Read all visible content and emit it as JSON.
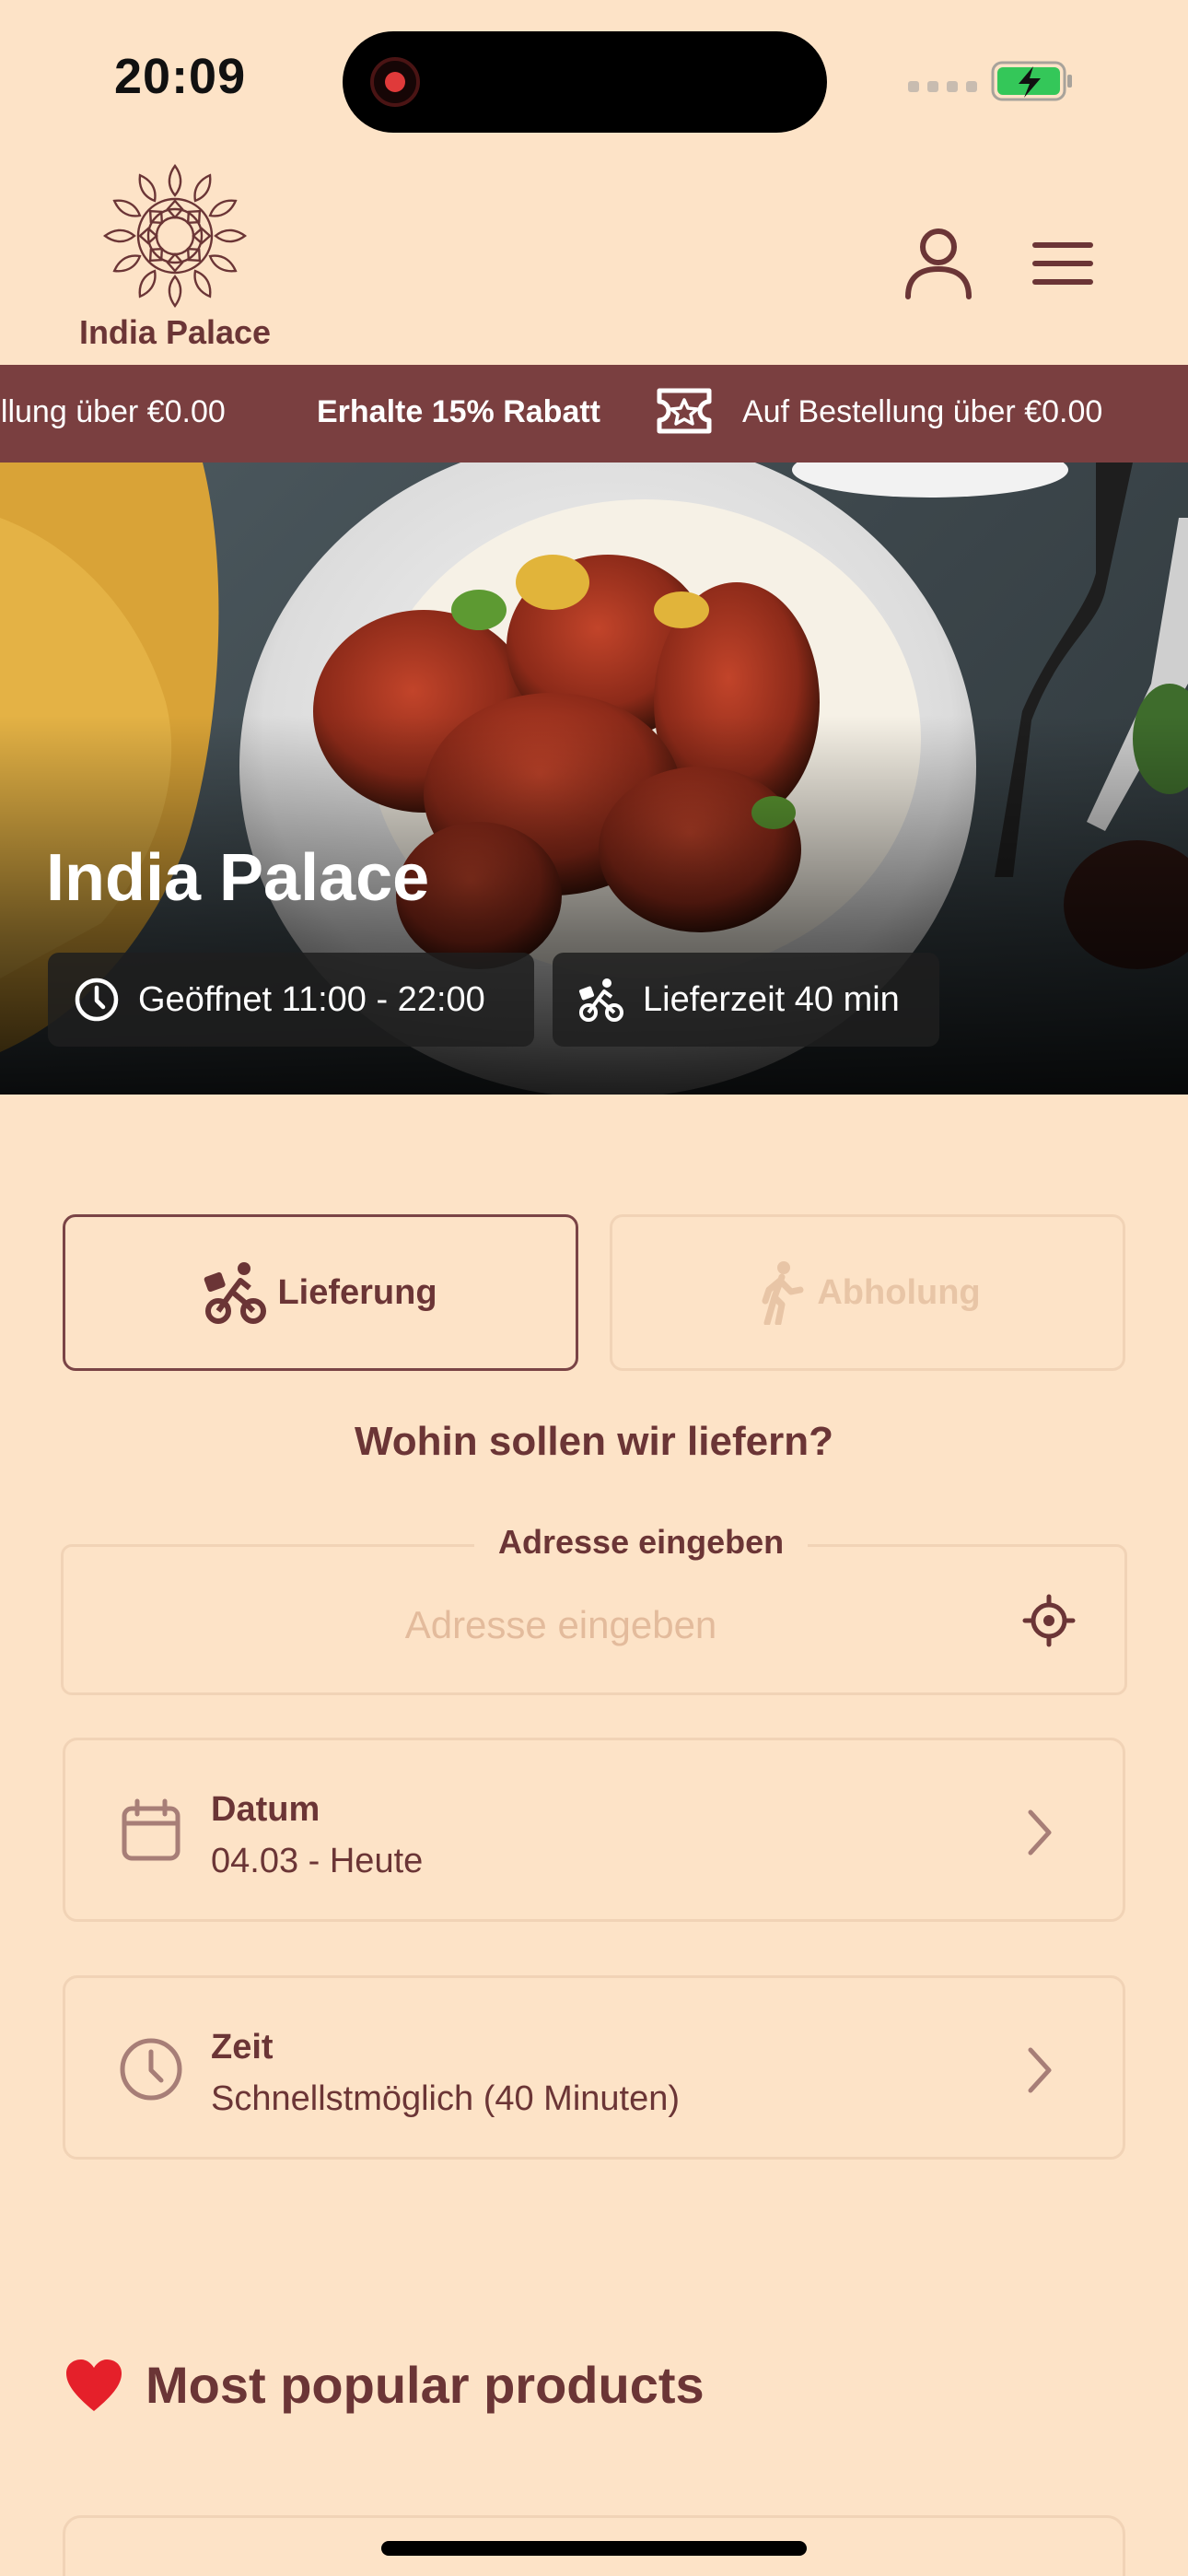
{
  "status_bar": {
    "time": "20:09"
  },
  "header": {
    "brand_name": "India Palace"
  },
  "promo_banner": {
    "text_left": "ellung über €0.00",
    "highlight": "Erhalte 15% Rabatt",
    "text_right": "Auf Bestellung über €0.00"
  },
  "hero": {
    "restaurant_name": "India Palace",
    "opening_hours": "Geöffnet 11:00 - 22:00",
    "delivery_time": "Lieferzeit 40 min"
  },
  "order_mode": {
    "delivery_label": "Lieferung",
    "pickup_label": "Abholung",
    "selected": "delivery"
  },
  "delivery_question": "Wohin sollen wir liefern?",
  "address": {
    "legend": "Adresse eingeben",
    "placeholder": "Adresse eingeben",
    "value": ""
  },
  "date_card": {
    "label": "Datum",
    "value": "04.03 - Heute"
  },
  "time_card": {
    "label": "Zeit",
    "value": "Schnellstmöglich (40 Minuten)"
  },
  "popular_section": {
    "emoji": "❤️",
    "title": "Most popular products"
  },
  "colors": {
    "background": "#FDE3C7",
    "brand": "#6B3536",
    "banner": "#7A3F40",
    "border": "#F1D3B6",
    "battery": "#34C759"
  }
}
